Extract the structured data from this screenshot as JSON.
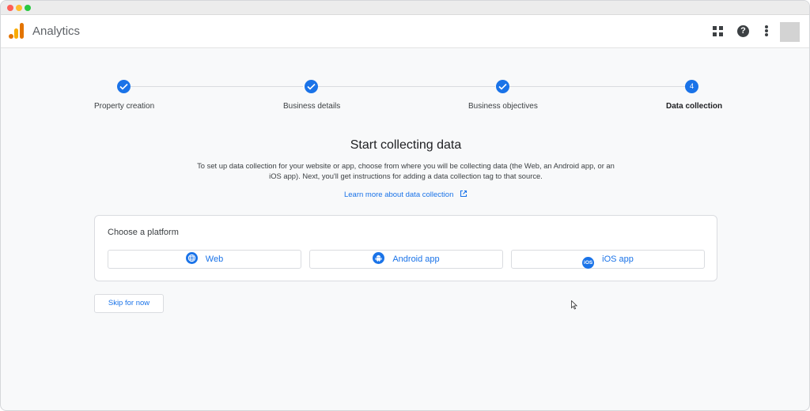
{
  "app": {
    "title": "Analytics"
  },
  "icons": {
    "logo": "analytics-logo",
    "apps": "apps-grid-icon",
    "help": "help-icon",
    "more": "more-vert-icon",
    "check": "check-icon",
    "web": "globe-icon",
    "android": "android-icon",
    "ios": "ios-icon",
    "external": "open-in-new-icon"
  },
  "header": {
    "help_glyph": "?"
  },
  "stepper": {
    "steps": [
      {
        "label": "Property creation",
        "state": "done"
      },
      {
        "label": "Business details",
        "state": "done"
      },
      {
        "label": "Business objectives",
        "state": "done"
      },
      {
        "label": "Data collection",
        "state": "active",
        "number": "4"
      }
    ]
  },
  "main": {
    "heading": "Start collecting data",
    "description": "To set up data collection for your website or app, choose from where you will be collecting data (the Web, an Android app, or an iOS app). Next, you'll get instructions for adding a data collection tag to that source.",
    "learn_more": "Learn more about data collection"
  },
  "platform_card": {
    "title": "Choose a platform",
    "buttons": [
      {
        "label": "Web"
      },
      {
        "label": "Android app"
      },
      {
        "label": "iOS app",
        "icon_text": "iOS"
      }
    ]
  },
  "skip_button": "Skip for now",
  "colors": {
    "accent": "#1a73e8",
    "background": "#f8f9fa",
    "logo_orange": "#e37400",
    "logo_yellow": "#f9ab00"
  }
}
